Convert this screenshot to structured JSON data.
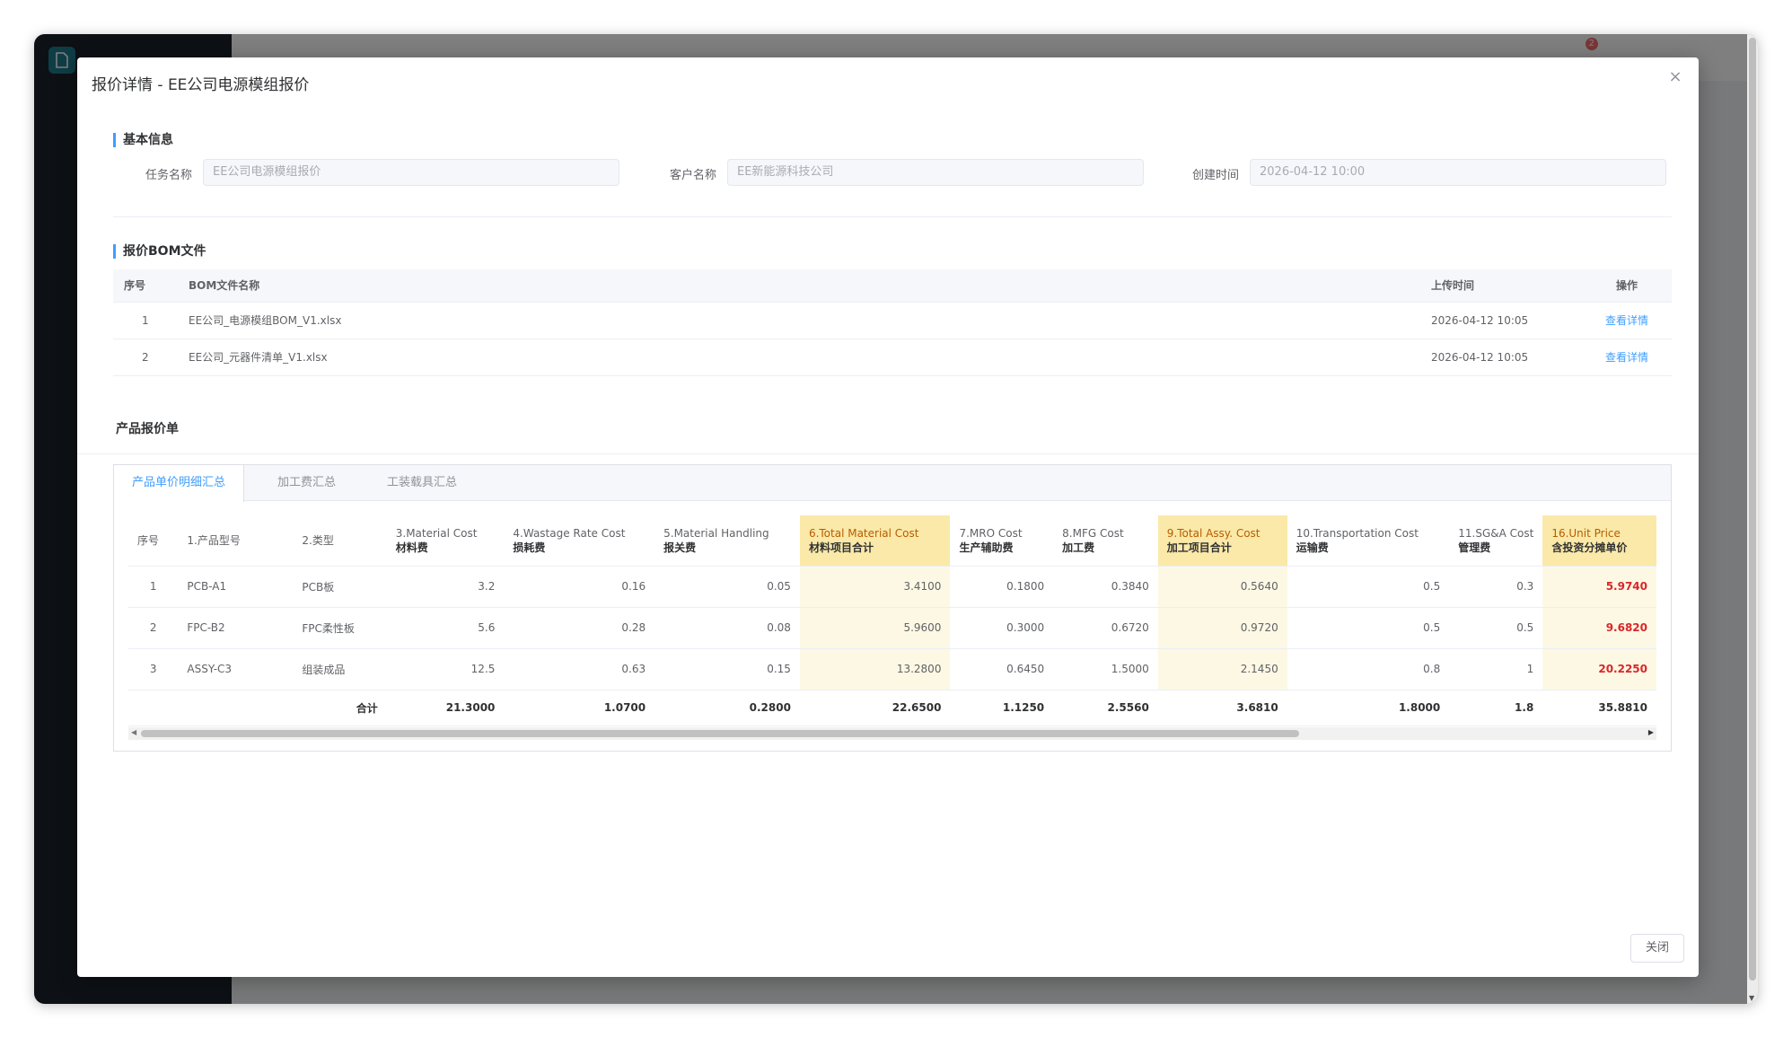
{
  "background_app": {
    "badge_count": "2"
  },
  "modal": {
    "title": "报价详情 - EE公司电源模组报价",
    "close_button_label": "关闭"
  },
  "basic_info": {
    "section_title": "基本信息",
    "task_name_label": "任务名称",
    "task_name_value": "EE公司电源模组报价",
    "customer_label": "客户名称",
    "customer_value": "EE新能源科技公司",
    "created_label": "创建时间",
    "created_value": "2026-04-12 10:00"
  },
  "bom": {
    "section_title": "报价BOM文件",
    "columns": [
      "序号",
      "BOM文件名称",
      "上传时间",
      "操作"
    ],
    "rows": [
      {
        "index": "1",
        "name": "EE公司_电源模组BOM_V1.xlsx",
        "time": "2026-04-12 10:05",
        "action": "查看详情"
      },
      {
        "index": "2",
        "name": "EE公司_元器件清单_V1.xlsx",
        "time": "2026-04-12 10:05",
        "action": "查看详情"
      }
    ]
  },
  "quote": {
    "section_title": "产品报价单",
    "tabs": [
      "产品单价明细汇总",
      "加工费汇总",
      "工装载具汇总"
    ],
    "active_tab": "产品单价明细汇总",
    "columns": [
      {
        "l1": "序号",
        "l2": ""
      },
      {
        "l1": "1.产品型号",
        "l2": ""
      },
      {
        "l1": "2.类型",
        "l2": ""
      },
      {
        "l1": "3.Material Cost",
        "l2": "材料费"
      },
      {
        "l1": "4.Wastage Rate Cost",
        "l2": "损耗费"
      },
      {
        "l1": "5.Material Handling",
        "l2": "报关费"
      },
      {
        "l1": "6.Total Material Cost",
        "l2": "材料项目合计"
      },
      {
        "l1": "7.MRO Cost",
        "l2": "生产辅助费"
      },
      {
        "l1": "8.MFG Cost",
        "l2": "加工费"
      },
      {
        "l1": "9.Total Assy. Cost",
        "l2": "加工项目合计"
      },
      {
        "l1": "10.Transportation Cost",
        "l2": "运输费"
      },
      {
        "l1": "11.SG&A Cost",
        "l2": "管理费"
      },
      {
        "l1": "16.Unit Price",
        "l2": "含投资分摊单价"
      }
    ],
    "rows": [
      [
        "1",
        "PCB-A1",
        "PCB板",
        "3.2",
        "0.16",
        "0.05",
        "3.4100",
        "0.1800",
        "0.3840",
        "0.5640",
        "0.5",
        "0.3",
        "5.9740"
      ],
      [
        "2",
        "FPC-B2",
        "FPC柔性板",
        "5.6",
        "0.28",
        "0.08",
        "5.9600",
        "0.3000",
        "0.6720",
        "0.9720",
        "0.5",
        "0.5",
        "9.6820"
      ],
      [
        "3",
        "ASSY-C3",
        "组装成品",
        "12.5",
        "0.63",
        "0.15",
        "13.2800",
        "0.6450",
        "1.5000",
        "2.1450",
        "0.8",
        "1",
        "20.2250"
      ]
    ],
    "total": [
      "",
      "",
      "合计",
      "21.3000",
      "1.0700",
      "0.2800",
      "22.6500",
      "1.1250",
      "2.5560",
      "3.6810",
      "1.8000",
      "1.8",
      "35.8810"
    ]
  },
  "colors": {
    "accent": "#409eff",
    "highlight_header": "#fae9a8",
    "highlight_cell": "#fdf8e4",
    "unit_price": "#d9262b"
  }
}
